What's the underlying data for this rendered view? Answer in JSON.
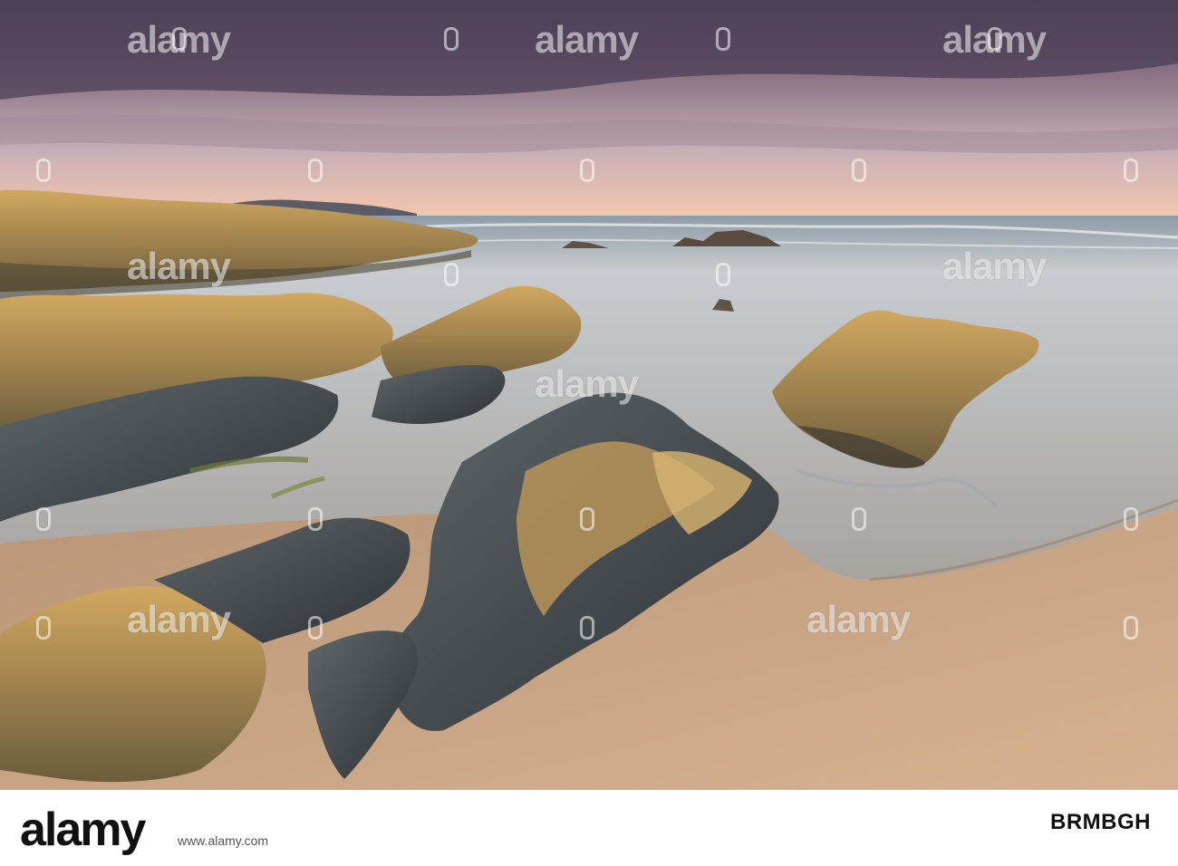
{
  "photo": {
    "subject": "beach",
    "palette": {
      "sky_top": "#5f5068",
      "sky_mid": "#b59aa8",
      "sky_glow": "#f3c3a8",
      "sea": "#b8c3c8",
      "sand": "#c9a584",
      "rock_light": "#c79a55",
      "rock_dark": "#3e434a"
    }
  },
  "watermark": {
    "text": "alamy"
  },
  "footer": {
    "logo": "alamy",
    "image_id": "BRMBGH",
    "url": "www.alamy.com"
  }
}
